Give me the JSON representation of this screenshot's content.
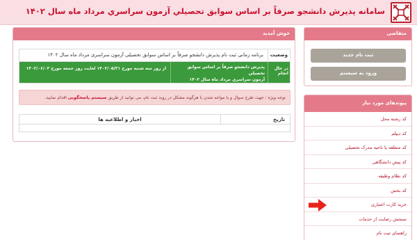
{
  "header": {
    "title": "سامانه پذیرش دانشجو صرفاً بر اساس سوابق تحصیلي آزمون سراسري مرداد ماه سال ۱۴۰۲"
  },
  "main": {
    "panel_title": "خوش آمدید",
    "table": {
      "col_status": "وضعیت",
      "col_program": "برنامه زمانی ثبت نام پذیرش دانشجو صرفاً بر اساس سوابق تحصیلی آزمون سراسری مرداد ماه سال ۱۴۰۲",
      "status_value": "در حال انجام",
      "process_line1": "پذیرش دانشجو صرفاً بر اساس سوابق تحصیلي",
      "process_line2": "آزمون سراسري مرداد ماه سال ۱۴۰۲",
      "date_range": "از روز سه شنبه مورخ ۱۴۰۲/۰۵/۳۱ لغایت روز جمعه مورخ ۱۴۰۲/۰۶/۰۳"
    },
    "alert": {
      "prefix": "توجه ویژه : جهت طرح سوال و یا مواجه شدن با هرگونه مشکل در روند ثبت نام، می توانید از طریق",
      "link": "سیستم پاسخگویی",
      "suffix": "اقدام نمایید."
    },
    "news": {
      "col_date": "تاریخ",
      "col_news": "اخبار و اطلاعیه ها"
    }
  },
  "sidebar": {
    "applicant_title": "متقاضی",
    "register_button": "ثبت نام جدید",
    "login_button": "ورود به سیستم",
    "links_title": "پیوندهای مورد نیاز",
    "links": [
      "کد رشته محل",
      "کد دیپلم",
      "کد منطقه یا ناحیه مدرک تحصیلی",
      "کد پیش دانشگاهی",
      "کد نظام وظیفه",
      "کد بخش",
      "خرید کارت اعتباری",
      "سنجش رضایت از خدمات",
      "راهنمای ثبت نام"
    ]
  },
  "colors": {
    "header_bg": "#f9dfe3",
    "title_red": "#c8102e",
    "panel_head": "#e47a89",
    "status_green": "#3b9a3b",
    "button_gray": "#aaa39a",
    "arrow_red": "#e8231c"
  },
  "icons": {
    "logo": "sanjesh-logo-icon",
    "arrow": "arrow-pointer-icon"
  }
}
